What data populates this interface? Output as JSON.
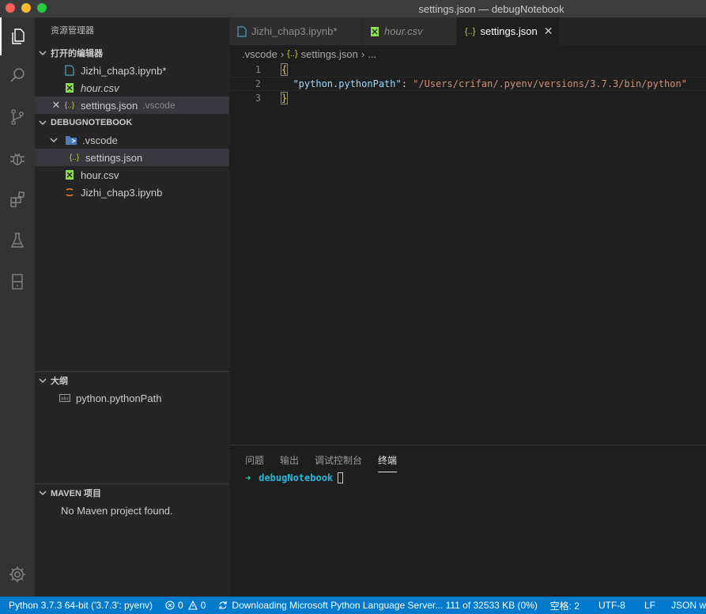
{
  "window": {
    "title": "settings.json — debugNotebook"
  },
  "activity_bar": {
    "items": [
      "files-icon",
      "search-icon",
      "source-control-icon",
      "debug-icon",
      "extensions-icon",
      "test-flask-icon",
      "notebook-icon"
    ],
    "bottom": "gear-icon"
  },
  "sidebar": {
    "title": "资源管理器",
    "open_editors": {
      "header": "打开的编辑器",
      "items": [
        {
          "label": "Jizhi_chap3.ipynb*",
          "icon": "notebook-file-icon"
        },
        {
          "label": "hour.csv",
          "icon": "csv-file-icon"
        },
        {
          "label": "settings.json",
          "description": ".vscode",
          "icon": "json-file-icon"
        }
      ]
    },
    "workspace": {
      "header": "DEBUGNOTEBOOK",
      "folder": ".vscode",
      "items": [
        {
          "label": "settings.json",
          "icon": "json-file-icon"
        },
        {
          "label": "hour.csv",
          "icon": "csv-file-icon"
        },
        {
          "label": "Jizhi_chap3.ipynb",
          "icon": "jupyter-file-icon"
        }
      ]
    },
    "outline": {
      "header": "大纲",
      "items": [
        {
          "label": "python.pythonPath"
        }
      ]
    },
    "maven": {
      "header": "MAVEN 项目",
      "message": "No Maven project found."
    }
  },
  "tabs": [
    {
      "label": "Jizhi_chap3.ipynb*",
      "icon": "notebook-file-icon",
      "active": false
    },
    {
      "label": "hour.csv",
      "icon": "csv-file-icon",
      "active": false
    },
    {
      "label": "settings.json",
      "icon": "json-file-icon",
      "active": true
    }
  ],
  "breadcrumb": {
    "folder": ".vscode",
    "file": "settings.json",
    "more": "..."
  },
  "editor": {
    "lines": [
      {
        "number": "1",
        "open": "{"
      },
      {
        "number": "2",
        "key": "\"python.pythonPath\"",
        "colon": ": ",
        "value": "\"/Users/crifan/.pyenv/versions/3.7.3/bin/python\""
      },
      {
        "number": "3",
        "close": "}"
      }
    ]
  },
  "panel": {
    "tabs": [
      "问题",
      "输出",
      "调试控制台",
      "终端"
    ],
    "active_tab": "终端",
    "terminal": {
      "prompt_arrow": "➜",
      "directory": "debugNotebook"
    }
  },
  "status_bar": {
    "python": "Python 3.7.3 64-bit ('3.7.3': pyenv)",
    "errors": "0",
    "warnings": "0",
    "download": "Downloading Microsoft Python Language Server... 111 of 32533 KB (0%)",
    "indent": "空格: 2",
    "encoding": "UTF-8",
    "eol": "LF",
    "language": "JSON w"
  },
  "colors": {
    "accent": "#007acc",
    "json_icon": "#cbcb41",
    "csv_icon": "#89e051",
    "jupyter_icon": "#f37626",
    "notebook_icon": "#519aba"
  }
}
